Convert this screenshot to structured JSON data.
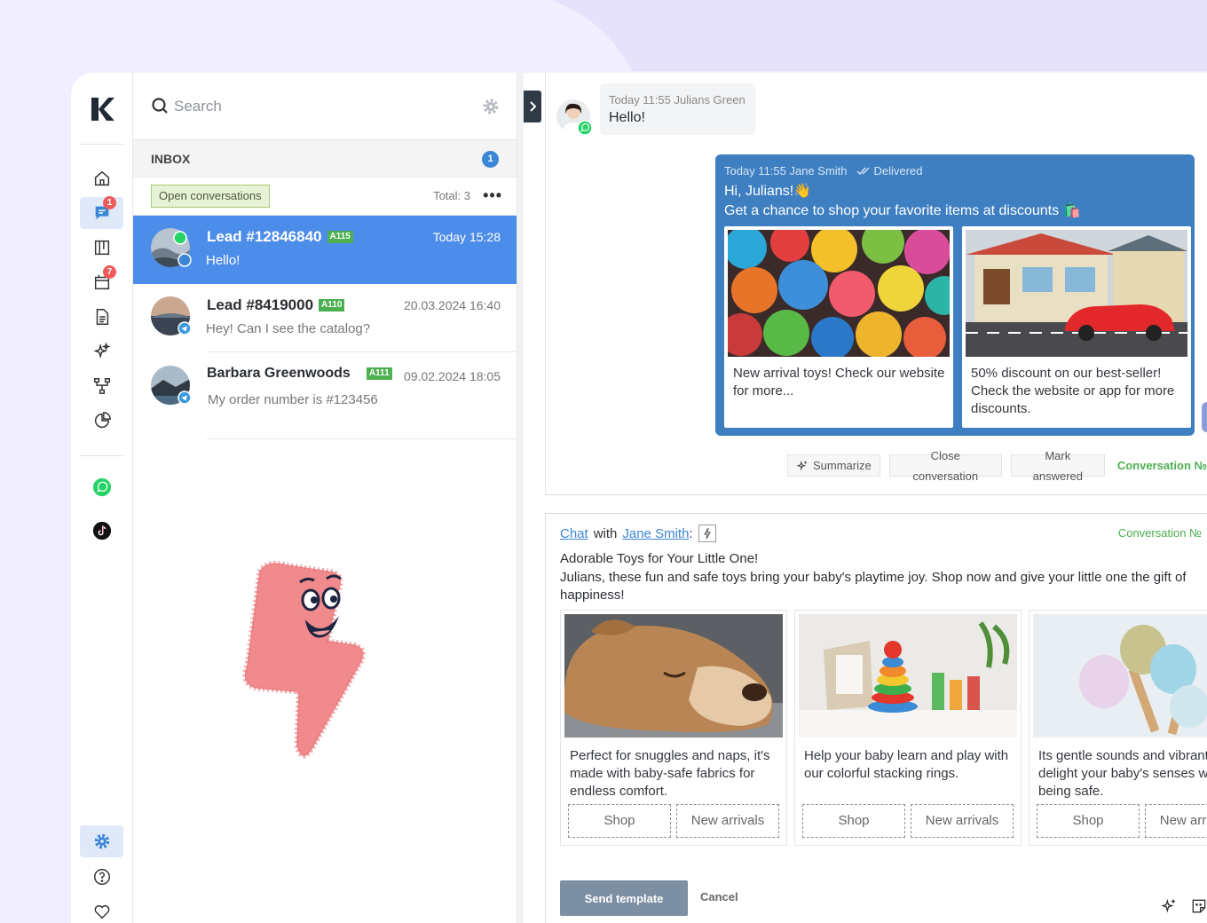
{
  "sidebar": {
    "badges": {
      "chats": "1",
      "calendar": "7"
    }
  },
  "list": {
    "search_placeholder": "Search",
    "inbox_title": "INBOX",
    "inbox_count": "1",
    "filter_label": "Open conversations",
    "total": "Total: 3",
    "conversations": [
      {
        "title": "Lead #12846840",
        "tag": "A115",
        "time": "Today 15:28",
        "message": "Hello!"
      },
      {
        "title": "Lead #8419000",
        "tag": "A110",
        "time": "20.03.2024 16:40",
        "message": "Hey! Can I see the catalog?"
      },
      {
        "title": "Barbara Greenwoods",
        "tag": "A111",
        "time": "09.02.2024 18:05",
        "message": "My order number is #123456"
      }
    ]
  },
  "feed": {
    "incoming": {
      "meta": "Today 11:55 Julians Green",
      "text": "Hello!"
    },
    "outgoing": {
      "meta": "Today 11:55 Jane Smith",
      "status": "Delivered",
      "line1": "Hi, Julians!👋",
      "line2": "Get a chance to shop your favorite items at discounts 🛍️",
      "cards": [
        {
          "text": "New arrival toys! Check our website for more..."
        },
        {
          "text": "50% discount on our best-seller! Check the website or app for more discounts."
        }
      ]
    },
    "actions": {
      "summarize": "Summarize",
      "close": "Close conversation",
      "mark": "Mark answered",
      "conversation_no": "Conversation №"
    }
  },
  "composer": {
    "chat_label": "Chat",
    "with_label": "with",
    "user_name": "Jane Smith",
    "colon": ":",
    "conversation_no": "Conversation №",
    "header": "Adorable Toys for Your Little One!",
    "body": "Julians, these fun and safe toys bring your baby's playtime joy. Shop now and give your little one the gift of happiness!",
    "cards": [
      {
        "text": "Perfect for snuggles and naps, it's made with baby-safe fabrics for endless comfort.",
        "btn1": "Shop",
        "btn2": "New arrivals"
      },
      {
        "text": "Help your baby learn and play with our colorful stacking rings.",
        "btn1": "Shop",
        "btn2": "New arrivals"
      },
      {
        "text": "Its gentle sounds and vibrant colors delight your baby's senses while being safe.",
        "btn1": "Shop",
        "btn2": "New arrivals"
      }
    ],
    "send_label": "Send template",
    "cancel_label": "Cancel"
  },
  "colors": {
    "accent": "#4d8dea",
    "bubble": "#3e7fc2",
    "success": "#4caf50",
    "badge": "#ef5a5a"
  }
}
